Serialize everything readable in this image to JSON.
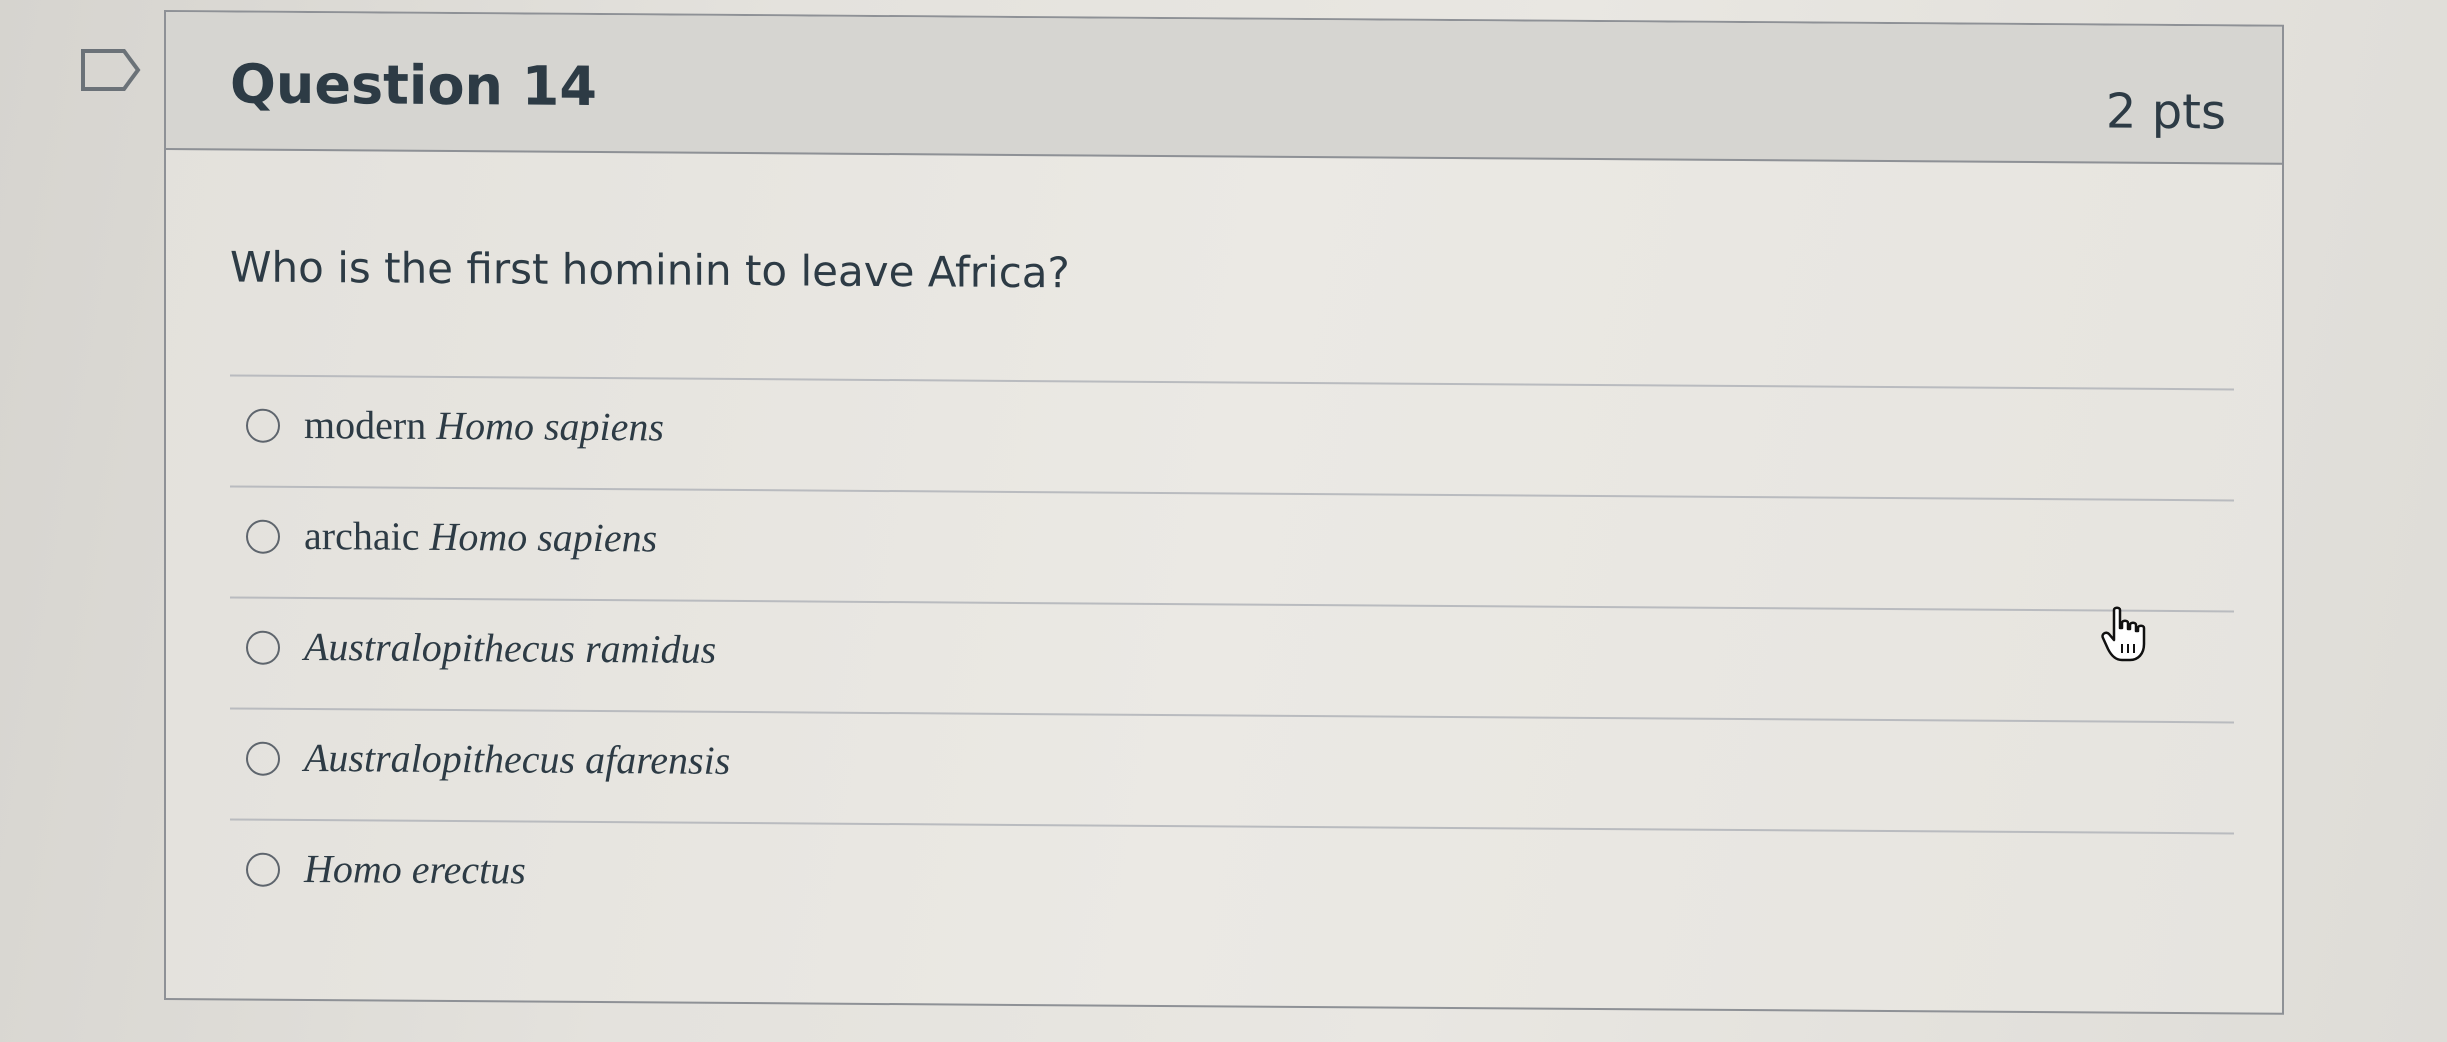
{
  "question": {
    "title": "Question 14",
    "points": "2 pts",
    "text": "Who is the first hominin to leave Africa?"
  },
  "answers": [
    {
      "prefix": "modern ",
      "italic": "Homo sapiens"
    },
    {
      "prefix": "archaic ",
      "italic": "Homo sapiens"
    },
    {
      "prefix": "",
      "italic": "Australopithecus ramidus"
    },
    {
      "prefix": "",
      "italic": "Australopithecus afarensis"
    },
    {
      "prefix": "",
      "italic": "Homo erectus"
    }
  ],
  "icons": {
    "flag": "flag-question-icon",
    "cursor": "hand-pointer-cursor-icon",
    "radio": "radio-button-icon"
  },
  "colors": {
    "text": "#2d3b45",
    "border": "#8e9196",
    "header_bg": "#d6d5d1"
  }
}
